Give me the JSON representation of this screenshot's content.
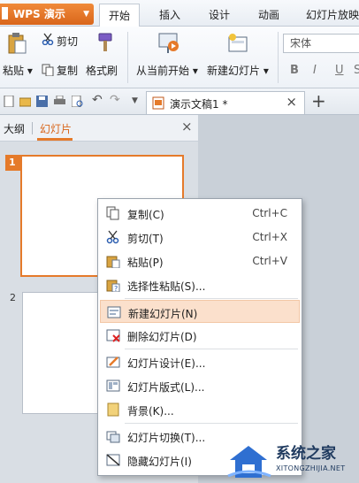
{
  "app": {
    "name": "WPS 演示"
  },
  "tabs": [
    {
      "label": "开始",
      "active": true
    },
    {
      "label": "插入"
    },
    {
      "label": "设计"
    },
    {
      "label": "动画"
    },
    {
      "label": "幻灯片放映"
    }
  ],
  "ribbon": {
    "paste": "粘贴",
    "cut": "剪切",
    "copy": "复制",
    "format_painter": "格式刷",
    "from_current": "从当前开始",
    "new_slide": "新建幻灯片",
    "font_name": "宋体",
    "bold": "B",
    "italic": "I",
    "underline": "U",
    "strike": "S"
  },
  "document": {
    "tab_title": "演示文稿1 *"
  },
  "panel": {
    "tab_outline": "大纲",
    "tab_slides": "幻灯片",
    "slides": [
      {
        "number": "1"
      },
      {
        "number": "2"
      }
    ]
  },
  "context_menu": {
    "items": [
      {
        "label": "复制(C)",
        "shortcut": "Ctrl+C",
        "icon": "copy-icon"
      },
      {
        "label": "剪切(T)",
        "shortcut": "Ctrl+X",
        "icon": "scissors-icon"
      },
      {
        "label": "粘贴(P)",
        "shortcut": "Ctrl+V",
        "icon": "paste-icon"
      },
      {
        "label": "选择性粘贴(S)...",
        "shortcut": "",
        "icon": "paste-special-icon"
      },
      {
        "label": "新建幻灯片(N)",
        "shortcut": "",
        "icon": "new-slide-icon",
        "highlighted": true
      },
      {
        "label": "删除幻灯片(D)",
        "shortcut": "",
        "icon": "delete-slide-icon"
      },
      {
        "label": "幻灯片设计(E)...",
        "shortcut": "",
        "icon": "slide-design-icon"
      },
      {
        "label": "幻灯片版式(L)...",
        "shortcut": "",
        "icon": "slide-layout-icon"
      },
      {
        "label": "背景(K)...",
        "shortcut": "",
        "icon": "background-icon"
      },
      {
        "label": "幻灯片切换(T)...",
        "shortcut": "",
        "icon": "slide-transition-icon"
      },
      {
        "label": "隐藏幻灯片(I)",
        "shortcut": "",
        "icon": "hide-slide-icon"
      }
    ]
  },
  "watermark": {
    "title": "系统之家",
    "url": "XITONGZHIJIA.NET"
  },
  "colors": {
    "accent": "#e57a2a",
    "menu_highlight": "#fbe0cc"
  }
}
